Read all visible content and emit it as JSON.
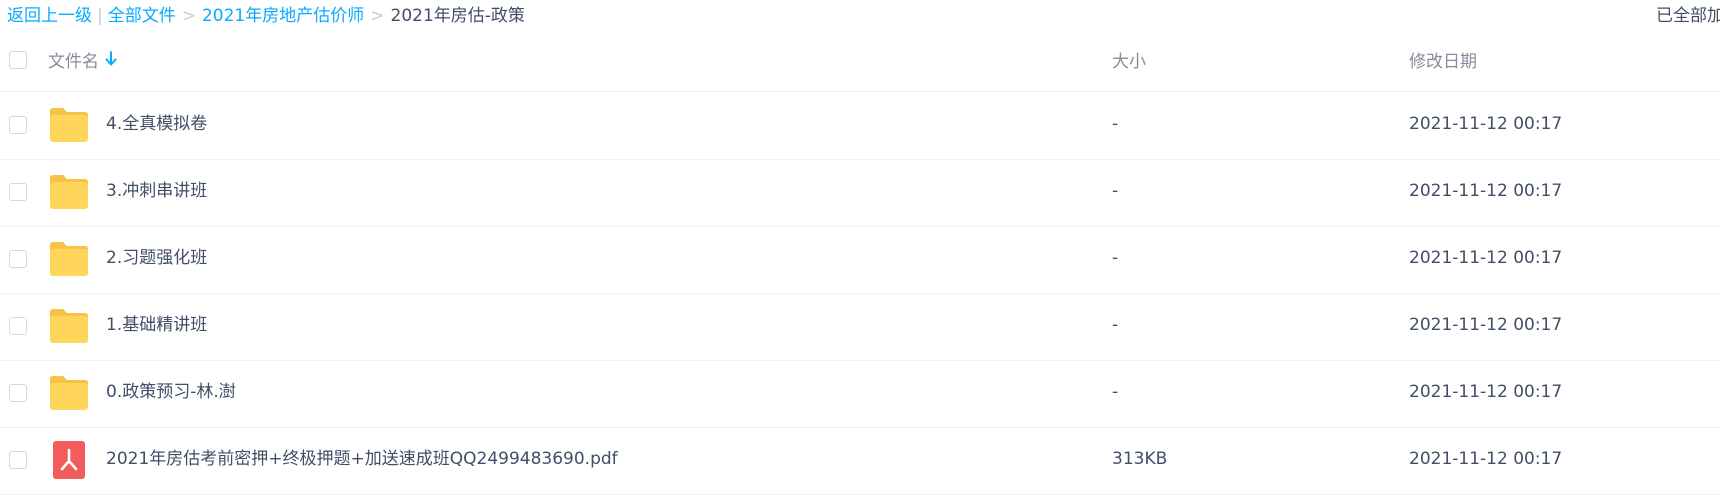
{
  "breadcrumb": {
    "back": "返回上一级",
    "all_files": "全部文件",
    "folder1": "2021年房地产估价师",
    "current": "2021年房估-政策",
    "separator": ">",
    "divider": "|"
  },
  "status": {
    "loaded_text": "已全部加"
  },
  "table": {
    "header": {
      "name": "文件名",
      "size": "大小",
      "date": "修改日期"
    },
    "rows": [
      {
        "icon": "folder-icon",
        "name": "4.全真模拟卷",
        "size": "-",
        "date": "2021-11-12 00:17"
      },
      {
        "icon": "folder-icon",
        "name": "3.冲刺串讲班",
        "size": "-",
        "date": "2021-11-12 00:17"
      },
      {
        "icon": "folder-icon",
        "name": "2.习题强化班",
        "size": "-",
        "date": "2021-11-12 00:17"
      },
      {
        "icon": "folder-icon",
        "name": "1.基础精讲班",
        "size": "-",
        "date": "2021-11-12 00:17"
      },
      {
        "icon": "folder-icon",
        "name": "0.政策预习-林.澍",
        "size": "-",
        "date": "2021-11-12 00:17"
      },
      {
        "icon": "pdf-icon",
        "name": "2021年房估考前密押+终极押题+加送速成班QQ2499483690.pdf",
        "size": "313KB",
        "date": "2021-11-12 00:17"
      }
    ]
  },
  "colors": {
    "link": "#09aaff",
    "folder": "#ffd659",
    "pdf": "#f25c5c",
    "text": "#424e67"
  }
}
